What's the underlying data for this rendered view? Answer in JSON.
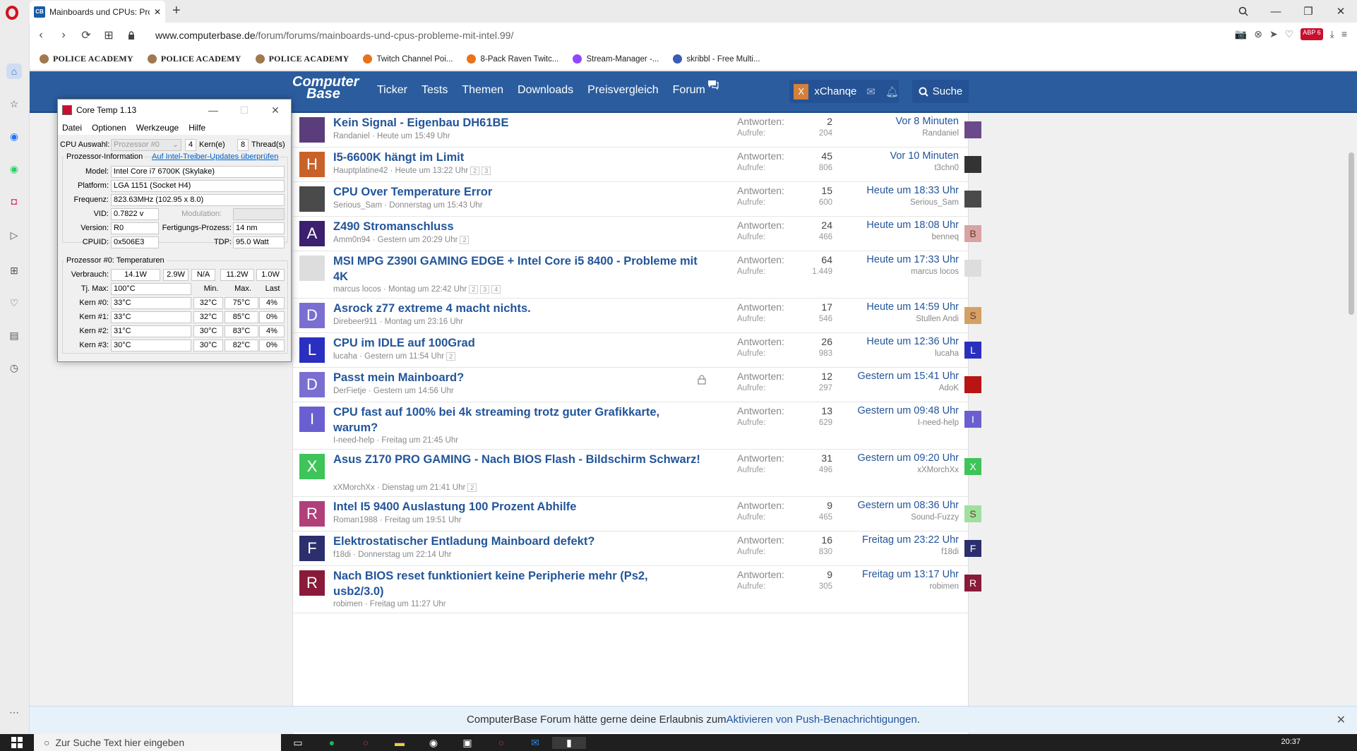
{
  "browser": {
    "tab_title": "Mainboards und CPUs: Pro",
    "tab_icon_text": "CB",
    "url_domain": "www.computerbase.de",
    "url_path": "/forum/forums/mainboards-und-cpus-probleme-mit-intel.99/",
    "bookmarks": [
      {
        "label": "POLICE ACADEMY",
        "icon": "badge-icon",
        "color": "#a07850"
      },
      {
        "label": "POLICE ACADEMY",
        "icon": "badge-icon",
        "color": "#a07850"
      },
      {
        "label": "POLICE ACADEMY",
        "icon": "badge-icon",
        "color": "#a07850"
      },
      {
        "label": "Twitch Channel Poi...",
        "icon": "play-icon",
        "color": "#e8731c"
      },
      {
        "label": "8-Pack Raven Twitc...",
        "icon": "play-icon",
        "color": "#e8731c"
      },
      {
        "label": "Stream-Manager -...",
        "icon": "twitch-icon",
        "color": "#9146ff"
      },
      {
        "label": "skribbl - Free Multi...",
        "icon": "pencil-icon",
        "color": "#3b5bb5"
      }
    ],
    "adblock_badge": "ABP",
    "adblock_count": "6"
  },
  "site": {
    "logo_line1": "Computer",
    "logo_line2": "Base",
    "nav": [
      "Ticker",
      "Tests",
      "Themen",
      "Downloads",
      "Preisvergleich",
      "Forum"
    ],
    "username": "xChanqe",
    "user_initial": "X",
    "search_label": "Suche"
  },
  "threads": [
    {
      "title": "Kein Signal - Eigenbau DH61BE",
      "author": "Randaniel",
      "date": "Heute um 15:49 Uhr",
      "pages": [],
      "replies": "2",
      "views": "204",
      "last_time": "Vor 8 Minuten",
      "last_user": "Randaniel",
      "initial": "",
      "color": "#5a3d7a",
      "last_color": "#6a4a8a",
      "last_initial": "",
      "locked": false
    },
    {
      "title": "I5-6600K hängt im Limit",
      "author": "Hauptplatine42",
      "date": "Heute um 13:22 Uhr",
      "pages": [
        "2",
        "3"
      ],
      "replies": "45",
      "views": "806",
      "last_time": "Vor 10 Minuten",
      "last_user": "t3chn0",
      "initial": "H",
      "color": "#c8622a",
      "last_color": "#333333",
      "last_initial": "",
      "locked": false
    },
    {
      "title": "CPU Over Temperature Error",
      "author": "Serious_Sam",
      "date": "Donnerstag um 15:43 Uhr",
      "pages": [],
      "replies": "15",
      "views": "600",
      "last_time": "Heute um 18:33 Uhr",
      "last_user": "Serious_Sam",
      "initial": "",
      "color": "#4a4a4a",
      "last_color": "#4a4a4a",
      "last_initial": "",
      "locked": false
    },
    {
      "title": "Z490 Stromanschluss",
      "author": "Amm0n94",
      "date": "Gestern um 20:29 Uhr",
      "pages": [
        "2"
      ],
      "replies": "24",
      "views": "466",
      "last_time": "Heute um 18:08 Uhr",
      "last_user": "benneq",
      "initial": "A",
      "color": "#3c1f6e",
      "last_color": "#d9a3a3",
      "last_initial": "B",
      "locked": false
    },
    {
      "title": "MSI MPG Z390I GAMING EDGE + Intel Core i5 8400 - Probleme mit 4K",
      "author": "marcus locos",
      "date": "Montag um 22:42 Uhr",
      "pages": [
        "2",
        "3",
        "4"
      ],
      "replies": "64",
      "views": "1.449",
      "last_time": "Heute um 17:33 Uhr",
      "last_user": "marcus locos",
      "initial": "",
      "color": "#dddddd",
      "last_color": "#dddddd",
      "last_initial": "",
      "locked": false
    },
    {
      "title": "Asrock z77 extreme 4 macht nichts.",
      "author": "Direbeer911",
      "date": "Montag um 23:16 Uhr",
      "pages": [],
      "replies": "17",
      "views": "546",
      "last_time": "Heute um 14:59 Uhr",
      "last_user": "Stullen Andi",
      "initial": "D",
      "color": "#7a6fd0",
      "last_color": "#d4a165",
      "last_initial": "S",
      "locked": false
    },
    {
      "title": "CPU im IDLE auf 100Grad",
      "author": "lucaha",
      "date": "Gestern um 11:54 Uhr",
      "pages": [
        "2"
      ],
      "replies": "26",
      "views": "983",
      "last_time": "Heute um 12:36 Uhr",
      "last_user": "lucaha",
      "initial": "L",
      "color": "#2a2fc0",
      "last_color": "#2a2fc0",
      "last_initial": "L",
      "locked": false
    },
    {
      "title": "Passt mein Mainboard?",
      "author": "DerFietje",
      "date": "Gestern um 14:56 Uhr",
      "pages": [],
      "replies": "12",
      "views": "297",
      "last_time": "Gestern um 15:41 Uhr",
      "last_user": "AdoK",
      "initial": "D",
      "color": "#7a6fd0",
      "last_color": "#b81414",
      "last_initial": "",
      "locked": true
    },
    {
      "title": "CPU fast auf 100% bei 4k streaming trotz guter Grafikkarte, warum?",
      "author": "I-need-help",
      "date": "Freitag um 21:45 Uhr",
      "pages": [],
      "replies": "13",
      "views": "629",
      "last_time": "Gestern um 09:48 Uhr",
      "last_user": "I-need-help",
      "initial": "I",
      "color": "#6a5fd0",
      "last_color": "#6a5fd0",
      "last_initial": "I",
      "locked": false
    },
    {
      "title": "Asus Z170 PRO GAMING - Nach BIOS Flash - Bildschirm Schwarz!",
      "author": "xXMorchXx",
      "date": "Dienstag um 21:41 Uhr",
      "pages": [
        "2"
      ],
      "replies": "31",
      "views": "496",
      "last_time": "Gestern um 09:20 Uhr",
      "last_user": "xXMorchXx",
      "initial": "X",
      "color": "#3ec45a",
      "last_color": "#3ec45a",
      "last_initial": "X",
      "locked": false
    },
    {
      "title": "Intel I5 9400 Auslastung 100 Prozent Abhilfe",
      "author": "Roman1988",
      "date": "Freitag um 19:51 Uhr",
      "pages": [],
      "replies": "9",
      "views": "465",
      "last_time": "Gestern um 08:36 Uhr",
      "last_user": "Sound-Fuzzy",
      "initial": "R",
      "color": "#b0407a",
      "last_color": "#9fe09f",
      "last_initial": "S",
      "locked": false
    },
    {
      "title": "Elektrostatischer Entladung Mainboard defekt?",
      "author": "f18di",
      "date": "Donnerstag um 22:14 Uhr",
      "pages": [],
      "replies": "16",
      "views": "830",
      "last_time": "Freitag um 23:22 Uhr",
      "last_user": "f18di",
      "initial": "F",
      "color": "#2b2f6e",
      "last_color": "#2b2f6e",
      "last_initial": "F",
      "locked": false
    },
    {
      "title": "Nach BIOS reset funktioniert keine Peripherie mehr (Ps2, usb2/3.0)",
      "author": "robimen",
      "date": "Freitag um 11:27 Uhr",
      "pages": [],
      "replies": "9",
      "views": "305",
      "last_time": "Freitag um 13:17 Uhr",
      "last_user": "robimen",
      "initial": "R",
      "color": "#8a1a3a",
      "last_color": "#8a1a3a",
      "last_initial": "R",
      "locked": false
    }
  ],
  "labels": {
    "replies": "Antworten:",
    "views": "Aufrufe:"
  },
  "push": {
    "text": "ComputerBase Forum hätte gerne deine Erlaubnis zum ",
    "link": "Aktivieren von Push-Benachrichtigungen",
    "tail": "."
  },
  "taskbar": {
    "search_placeholder": "Zur Suche Text hier eingeben",
    "time": "20:37"
  },
  "coretemp": {
    "title": "Core Temp 1.13",
    "menu": [
      "Datei",
      "Optionen",
      "Werkzeuge",
      "Hilfe"
    ],
    "cpu_select_label": "CPU Auswahl:",
    "cpu_select_value": "Prozessor #0",
    "cores": "4",
    "cores_label": "Kern(e)",
    "threads": "8",
    "threads_label": "Thread(s)",
    "info_label": "Prozessor-Information",
    "update_link": "Auf Intel-Treiber-Updates überprüfen",
    "model_label": "Model:",
    "model": "Intel Core i7 6700K (Skylake)",
    "platform_label": "Platform:",
    "platform": "LGA 1151 (Socket H4)",
    "freq_label": "Frequenz:",
    "freq": "823.63MHz (102.95 x 8.0)",
    "vid_label": "VID:",
    "vid": "0.7822 v",
    "modulation_label": "Modulation:",
    "version_label": "Version:",
    "version": "R0",
    "process_label": "Fertigungs-Prozess:",
    "process": "14 nm",
    "cpuid_label": "CPUID:",
    "cpuid": "0x506E3",
    "tdp_label": "TDP:",
    "tdp": "95.0 Watt",
    "temps_label": "Prozessor #0: Temperaturen",
    "power_label": "Verbrauch:",
    "power": [
      "14.1W",
      "2.9W",
      "N/A",
      "11.2W",
      "1.0W"
    ],
    "tjmax_label": "Tj. Max:",
    "tjmax": "100°C",
    "col_min": "Min.",
    "col_max": "Max.",
    "col_load": "Last",
    "cores_temps": [
      {
        "label": "Kern #0:",
        "temp": "33°C",
        "min": "32°C",
        "max": "75°C",
        "load": "4%"
      },
      {
        "label": "Kern #1:",
        "temp": "33°C",
        "min": "32°C",
        "max": "85°C",
        "load": "0%"
      },
      {
        "label": "Kern #2:",
        "temp": "31°C",
        "min": "30°C",
        "max": "83°C",
        "load": "4%"
      },
      {
        "label": "Kern #3:",
        "temp": "30°C",
        "min": "30°C",
        "max": "82°C",
        "load": "0%"
      }
    ]
  }
}
